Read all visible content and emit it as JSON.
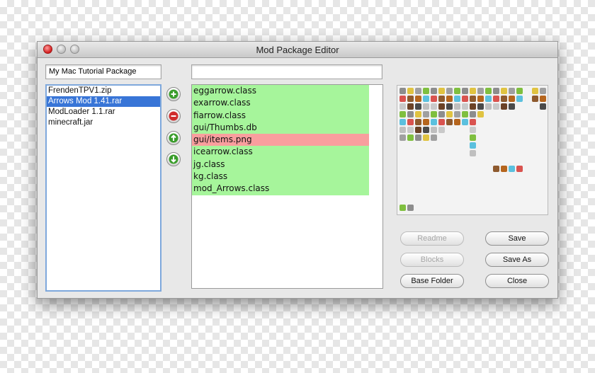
{
  "window": {
    "title": "Mod Package Editor"
  },
  "package_name": "My Mac Tutorial Package",
  "file_filter": "",
  "packages": [
    "FrendenTPV1.zip",
    "Arrows Mod 1.41.rar",
    "ModLoader 1.1.rar",
    "minecraft.jar"
  ],
  "selected_package_index": 1,
  "files": [
    {
      "name": "eggarrow.class",
      "status": "ok"
    },
    {
      "name": "exarrow.class",
      "status": "ok"
    },
    {
      "name": "fiarrow.class",
      "status": "ok"
    },
    {
      "name": "gui/Thumbs.db",
      "status": "ok"
    },
    {
      "name": "gui/items.png",
      "status": "conflict"
    },
    {
      "name": "icearrow.class",
      "status": "ok"
    },
    {
      "name": "jg.class",
      "status": "ok"
    },
    {
      "name": "kg.class",
      "status": "ok"
    },
    {
      "name": "mod_Arrows.class",
      "status": "ok"
    }
  ],
  "side_buttons": [
    {
      "name": "add-button",
      "icon": "plus-icon",
      "color": "#3a9d2b"
    },
    {
      "name": "remove-button",
      "icon": "minus-icon",
      "color": "#d02c2c"
    },
    {
      "name": "move-up-button",
      "icon": "arrow-up-icon",
      "color": "#3a9d2b"
    },
    {
      "name": "move-down-button",
      "icon": "arrow-down-icon",
      "color": "#3a9d2b"
    }
  ],
  "buttons": {
    "readme": "Readme",
    "blocks": "Blocks",
    "base_folder": "Base Folder",
    "save": "Save",
    "save_as": "Save As",
    "close": "Close"
  },
  "colors": {
    "ok": "#a6f59b",
    "conflict": "#f99e9e",
    "selection": "#3875d7"
  }
}
